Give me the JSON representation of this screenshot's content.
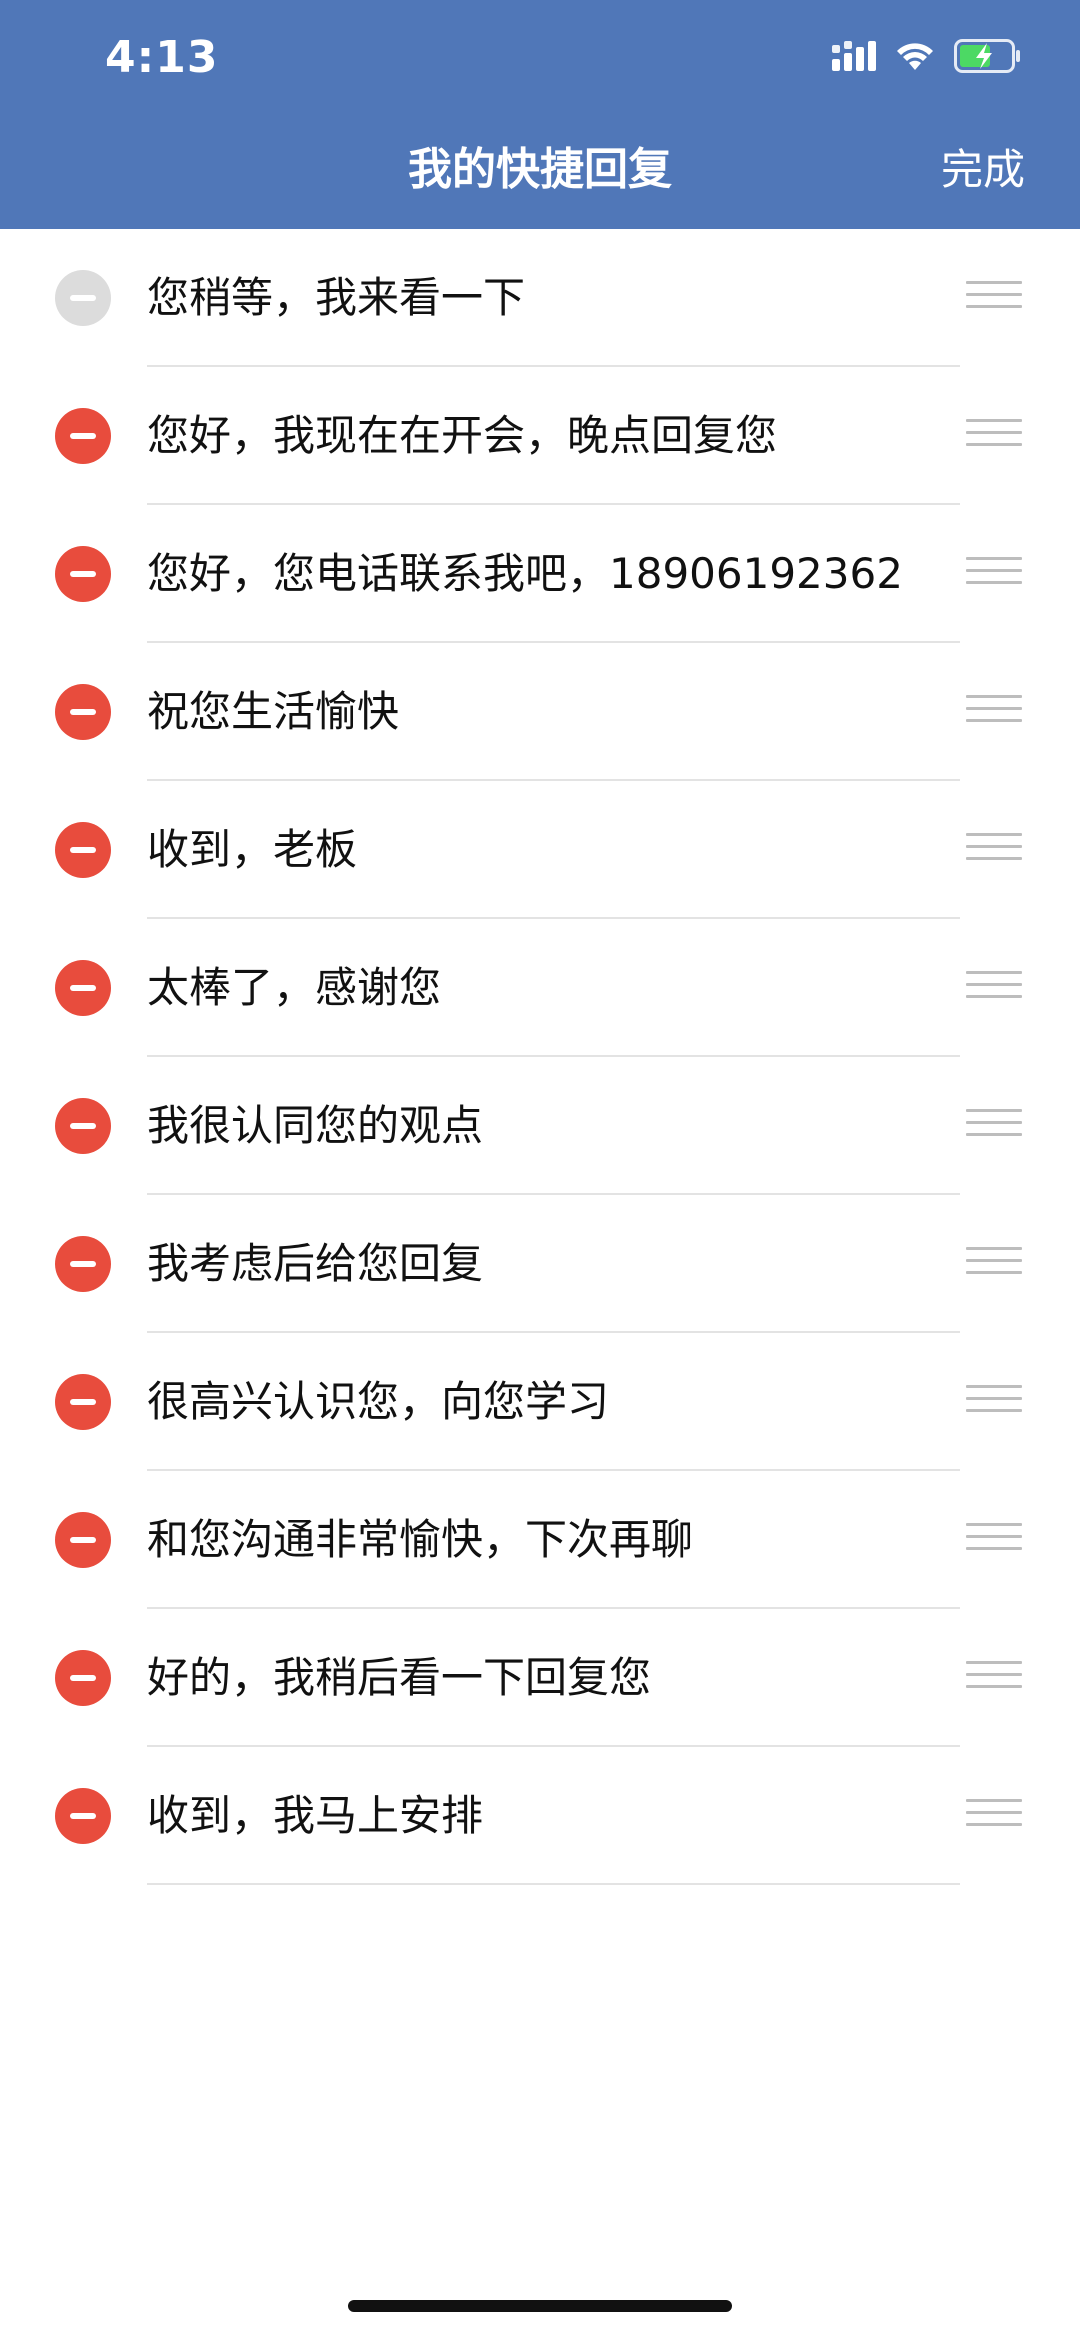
{
  "status_bar": {
    "time": "4:13",
    "icons": [
      "cellular-signal-icon",
      "wifi-icon",
      "battery-charging-icon"
    ]
  },
  "nav": {
    "title": "我的快捷回复",
    "done_label": "完成"
  },
  "colors": {
    "header_bg": "#5077b8",
    "delete_red": "#e84c3d",
    "delete_disabled": "#dcdcdc",
    "battery_green": "#4cd964"
  },
  "replies": [
    {
      "text": "您稍等，我来看一下",
      "deletable": false
    },
    {
      "text": "您好，我现在在开会，晚点回复您",
      "deletable": true
    },
    {
      "text": "您好，您电话联系我吧，18906192362",
      "deletable": true
    },
    {
      "text": "祝您生活愉快",
      "deletable": true
    },
    {
      "text": "收到，老板",
      "deletable": true
    },
    {
      "text": "太棒了，感谢您",
      "deletable": true
    },
    {
      "text": "我很认同您的观点",
      "deletable": true
    },
    {
      "text": "我考虑后给您回复",
      "deletable": true
    },
    {
      "text": "很高兴认识您，向您学习",
      "deletable": true
    },
    {
      "text": "和您沟通非常愉快，下次再聊",
      "deletable": true
    },
    {
      "text": "好的，我稍后看一下回复您",
      "deletable": true
    },
    {
      "text": "收到，我马上安排",
      "deletable": true
    }
  ]
}
